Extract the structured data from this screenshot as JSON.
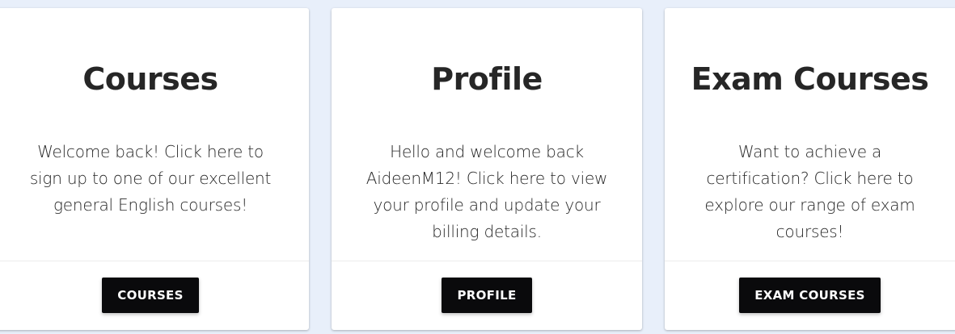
{
  "cards": [
    {
      "title": "Courses",
      "text": "Welcome back! Click here to sign up to one of our excellent general English courses!",
      "button_label": "COURSES"
    },
    {
      "title": "Profile",
      "text": "Hello and welcome back AideenM12! Click here to view your profile and update your billing details.",
      "button_label": "PROFILE"
    },
    {
      "title": "Exam Courses",
      "text": "Want to achieve a certification? Click here to explore our range of exam courses!",
      "button_label": "EXAM COURSES"
    }
  ],
  "colors": {
    "background": "#e8effa",
    "card": "#ffffff",
    "button": "#0a0a0c",
    "text": "#262626"
  }
}
